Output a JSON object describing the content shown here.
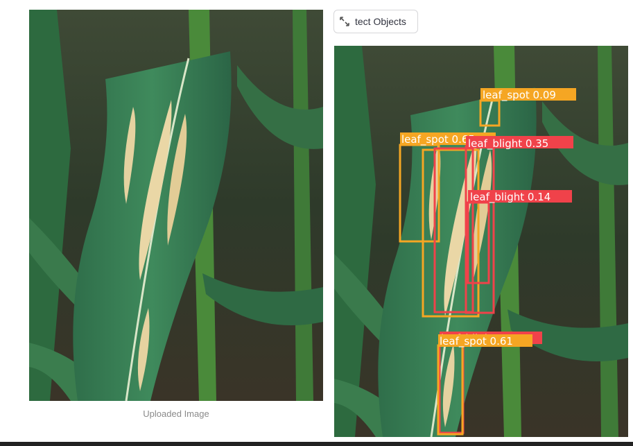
{
  "detect_button": {
    "label": "tect Objects",
    "icon": "expand-arrows-icon"
  },
  "uploaded": {
    "caption": "Uploaded Image"
  },
  "colors": {
    "leaf_spot": "#f5a623",
    "leaf_blight": "#f0424a",
    "label_text": "#ffffff"
  },
  "detections": [
    {
      "class": "leaf_spot",
      "score": "0.09",
      "label": "leaf_spot  0.09"
    },
    {
      "class": "leaf_spot",
      "score": "0.65",
      "label": "leaf_spot  0.65"
    },
    {
      "class": "leaf_blight",
      "score": "0.35",
      "label": "leaf_blight  0.35"
    },
    {
      "class": "leaf_blight",
      "score": "0.14",
      "label": "leaf_blight  0.14"
    },
    {
      "class": "leaf_blight",
      "score": "0.16",
      "label": "leaf_blight  0.16"
    },
    {
      "class": "leaf_spot",
      "score": "0.61",
      "label": "leaf_spot  0.61"
    }
  ]
}
